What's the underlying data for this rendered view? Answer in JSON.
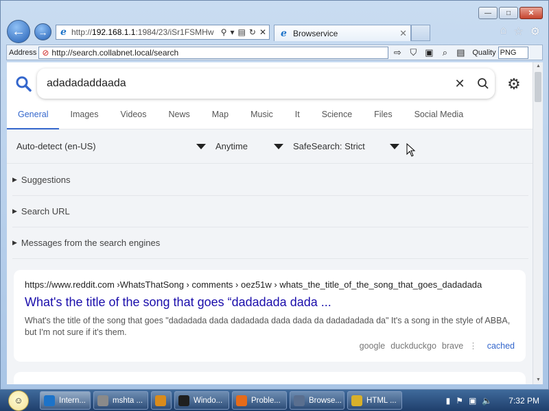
{
  "window": {
    "minimize": "—",
    "maximize": "□",
    "close": "✕"
  },
  "nav": {
    "back": "←",
    "forward": "→",
    "url_prefix": "http://",
    "url_host": "192.168.1.1",
    "url_rest": ":1984/23/iSr1FSMHw"
  },
  "tab": {
    "title": "Browservice",
    "close": "✕"
  },
  "addressbar": {
    "label": "Address",
    "value": "http://search.collabnet.local/search",
    "quality_label": "Quality",
    "quality_value": "PNG"
  },
  "search": {
    "query": "adadadaddaada",
    "clear": "✕",
    "submit": "⚲",
    "settings": "⚙"
  },
  "categories": [
    "General",
    "Images",
    "Videos",
    "News",
    "Map",
    "Music",
    "It",
    "Science",
    "Files",
    "Social Media"
  ],
  "active_category": "General",
  "filters": {
    "language": "Auto-detect (en-US)",
    "time": "Anytime",
    "safesearch": "SafeSearch: Strict"
  },
  "sections": {
    "suggestions": "Suggestions",
    "search_url": "Search URL",
    "messages": "Messages from the search engines"
  },
  "result": {
    "url": "https://www.reddit.com ›WhatsThatSong › comments › oez51w › whats_the_title_of_the_song_that_goes_dadadada",
    "title": "What's the title of the song that goes “dadadada dada ...",
    "snippet": "What's the title of the song that goes \"dadadada dada dadadada dada dada da dadadadada da\" It's a song in the style of ABBA, but I'm not sure if it's them.",
    "engines": [
      "google",
      "duckduckgo",
      "brave"
    ],
    "cached": "cached"
  },
  "taskbar": {
    "items": [
      {
        "label": "Intern...",
        "icon": "ie-icon",
        "color": "#1c73c9"
      },
      {
        "label": "mshta ...",
        "icon": "app-icon",
        "color": "#8a8a8a"
      },
      {
        "label": "",
        "icon": "media-icon",
        "color": "#d98b1b"
      },
      {
        "label": "Windo...",
        "icon": "terminal-icon",
        "color": "#1f1f1f"
      },
      {
        "label": "Proble...",
        "icon": "firefox-icon",
        "color": "#e66b19"
      },
      {
        "label": "Browse...",
        "icon": "window-icon",
        "color": "#5a6f8f"
      },
      {
        "label": "HTML ...",
        "icon": "help-icon",
        "color": "#d8b02a"
      }
    ],
    "clock": "7:32 PM"
  }
}
